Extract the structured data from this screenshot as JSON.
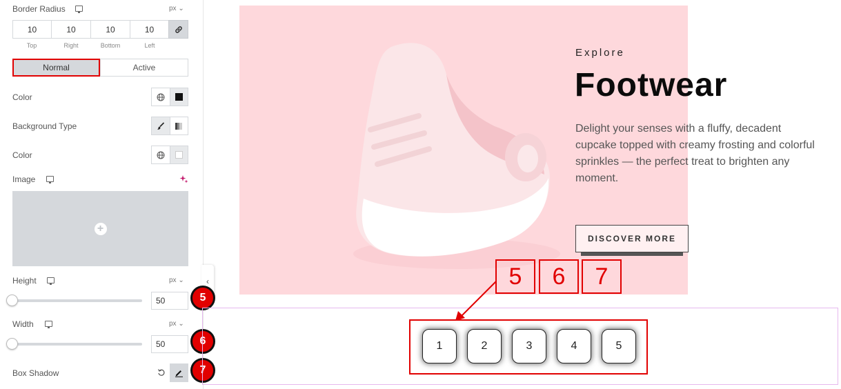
{
  "panel": {
    "border_radius": {
      "label": "Border Radius",
      "unit": "px ⌄",
      "values": {
        "top": "10",
        "right": "10",
        "bottom": "10",
        "left": "10"
      },
      "captions": {
        "top": "Top",
        "right": "Right",
        "bottom": "Bottom",
        "left": "Left"
      }
    },
    "tabs": {
      "normal": "Normal",
      "active": "Active"
    },
    "color_label": "Color",
    "background_type_label": "Background Type",
    "color2_label": "Color",
    "image_label": "Image",
    "height": {
      "label": "Height",
      "unit": "px ⌄",
      "value": "50"
    },
    "width": {
      "label": "Width",
      "unit": "px ⌄",
      "value": "50"
    },
    "box_shadow_label": "Box Shadow",
    "badges": {
      "b5": "5",
      "b6": "6",
      "b7": "7"
    }
  },
  "preview": {
    "explore": "Explore",
    "title": "Footwear",
    "description": "Delight your senses with a fluffy, decadent cupcake topped with creamy frosting and colorful sprinkles — the perfect treat to brighten any moment.",
    "button": "DISCOVER MORE",
    "callouts": {
      "c5": "5",
      "c6": "6",
      "c7": "7"
    },
    "pages": {
      "p1": "1",
      "p2": "2",
      "p3": "3",
      "p4": "4",
      "p5": "5"
    }
  },
  "colors": {
    "hero_bg": "#fed8dc",
    "annotation_red": "#e10000",
    "section_outline": "#e6b8ee",
    "panel_control_gray": "#d5d8dc"
  },
  "icons": [
    "desktop-icon",
    "link-icon",
    "globe-icon",
    "brush-icon",
    "gradient-icon",
    "ai-sparkle-icon",
    "plus-icon",
    "reset-icon",
    "pencil-icon",
    "chevron-left-icon"
  ]
}
